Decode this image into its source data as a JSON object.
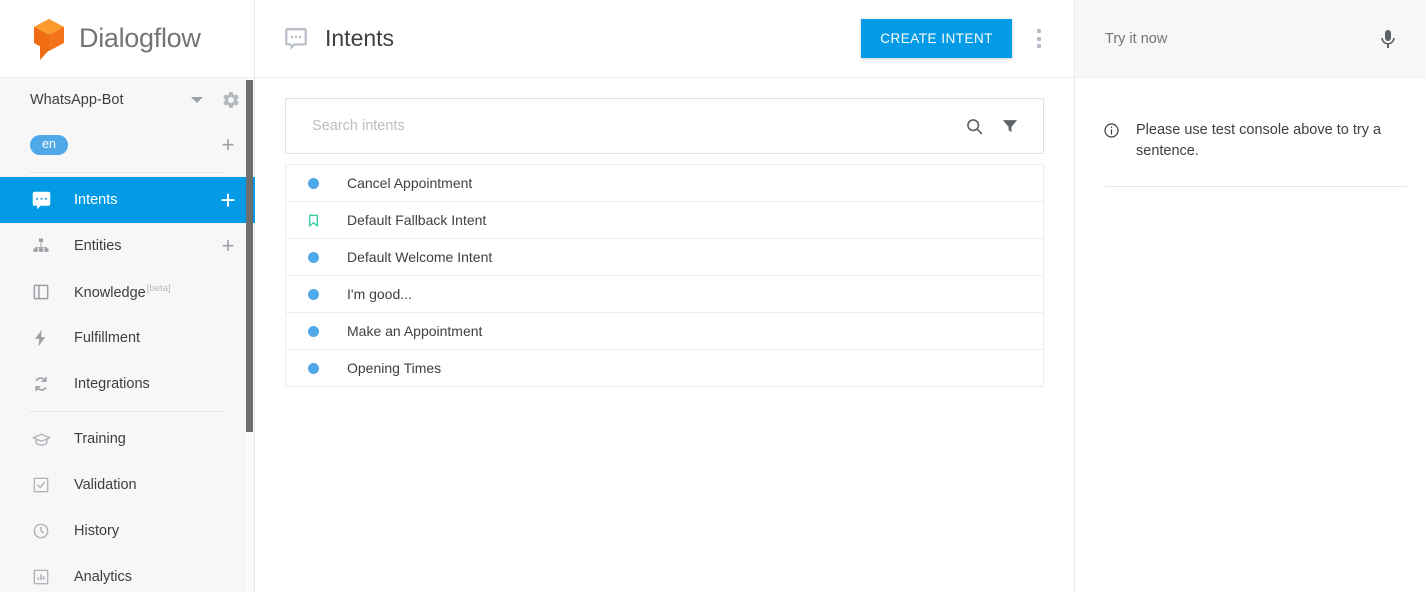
{
  "brand": {
    "logo_text": "Dialogflow",
    "logo_icon": "dialogflow-cube-logo",
    "orange": "#f4731c",
    "orange_light": "#fb8c00"
  },
  "colors": {
    "accent_blue": "#039be5",
    "dot_blue": "#4fa8e8",
    "fallback_teal": "#26c6a2",
    "sidebar_bg": "#f7f7f7",
    "text": "#3c4043"
  },
  "sidebar": {
    "project": {
      "name": "WhatsApp-Bot",
      "caret_icon": "chevron-down-icon",
      "settings_icon": "gear-icon"
    },
    "language": {
      "chip": "en",
      "add_icon": "plus-icon"
    },
    "items": [
      {
        "label": "Intents",
        "icon": "intents-chat-icon",
        "active": true,
        "has_add": true,
        "add_icon": "plus-icon"
      },
      {
        "label": "Entities",
        "icon": "entities-hierarchy-icon",
        "active": false,
        "has_add": true,
        "add_icon": "plus-icon"
      },
      {
        "label": "Knowledge",
        "icon": "knowledge-book-icon",
        "active": false,
        "has_add": false,
        "badge": "[beta]"
      },
      {
        "label": "Fulfillment",
        "icon": "fulfillment-bolt-icon",
        "active": false,
        "has_add": false
      },
      {
        "label": "Integrations",
        "icon": "integrations-refresh-icon",
        "active": false,
        "has_add": false
      }
    ],
    "items_secondary": [
      {
        "label": "Training",
        "icon": "training-graduation-cap-icon"
      },
      {
        "label": "Validation",
        "icon": "validation-checkbox-icon"
      },
      {
        "label": "History",
        "icon": "history-clock-icon"
      },
      {
        "label": "Analytics",
        "icon": "analytics-bar-chart-icon"
      }
    ]
  },
  "main": {
    "header": {
      "title": "Intents",
      "title_icon": "intents-chat-icon",
      "create_button": "CREATE INTENT",
      "menu_icon": "more-vert-icon"
    },
    "search": {
      "placeholder": "Search intents",
      "value": "",
      "search_icon": "search-icon",
      "filter_icon": "filter-icon"
    },
    "intents": [
      {
        "name": "Cancel Appointment",
        "marker": "dot"
      },
      {
        "name": "Default Fallback Intent",
        "marker": "bookmark"
      },
      {
        "name": "Default Welcome Intent",
        "marker": "dot"
      },
      {
        "name": "I'm good...",
        "marker": "dot"
      },
      {
        "name": "Make an Appointment",
        "marker": "dot"
      },
      {
        "name": "Opening Times",
        "marker": "dot"
      }
    ]
  },
  "right_panel": {
    "try_placeholder": "Try it now",
    "try_value": "",
    "mic_icon": "microphone-icon",
    "info_icon": "info-circle-icon",
    "hint": "Please use test console above to try a sentence."
  }
}
